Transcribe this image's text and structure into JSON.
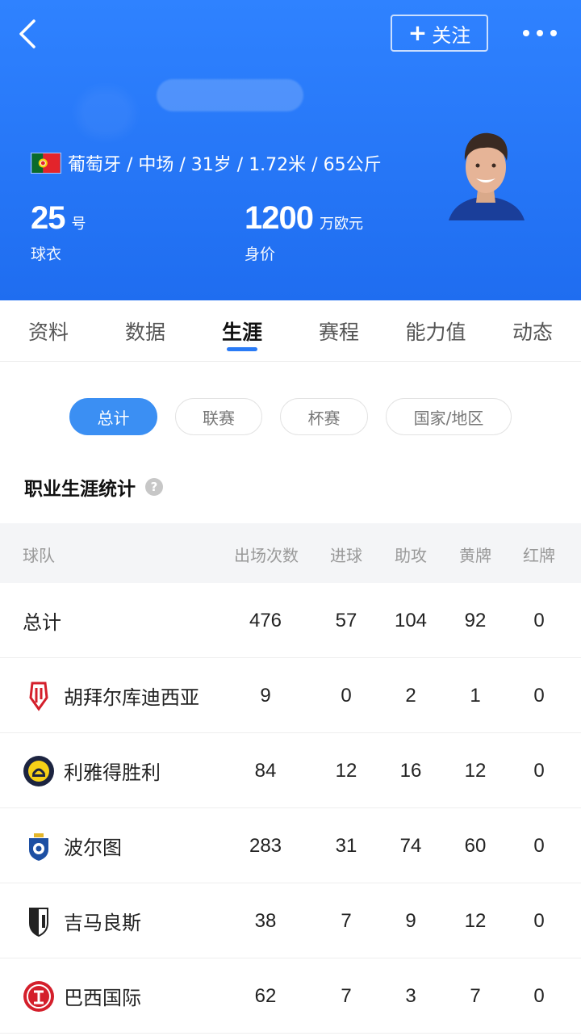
{
  "header": {
    "follow_label": "关注",
    "follow_plus": "+",
    "info_line": "葡萄牙 / 中场 / 31岁 / 1.72米 / 65公斤",
    "jersey": {
      "number": "25",
      "unit": "号",
      "label": "球衣"
    },
    "value": {
      "number": "1200",
      "unit": "万欧元",
      "label": "身价"
    }
  },
  "tabs": [
    "资料",
    "数据",
    "生涯",
    "赛程",
    "能力值",
    "动态"
  ],
  "active_tab": "生涯",
  "filters": [
    "总计",
    "联赛",
    "杯赛",
    "国家/地区"
  ],
  "active_filter": "总计",
  "section_title": "职业生涯统计",
  "help_icon": "?",
  "table": {
    "headers": [
      "球队",
      "出场次数",
      "进球",
      "助攻",
      "黄牌",
      "红牌"
    ],
    "rows": [
      {
        "team": "总计",
        "logo": "none",
        "apps": "476",
        "goals": "57",
        "assists": "104",
        "yellow": "92",
        "red": "0"
      },
      {
        "team": "胡拜尔库迪西亚",
        "logo": "al-qadsiah-logo",
        "apps": "9",
        "goals": "0",
        "assists": "2",
        "yellow": "1",
        "red": "0"
      },
      {
        "team": "利雅得胜利",
        "logo": "al-nassr-logo",
        "apps": "84",
        "goals": "12",
        "assists": "16",
        "yellow": "12",
        "red": "0"
      },
      {
        "team": "波尔图",
        "logo": "porto-logo",
        "apps": "283",
        "goals": "31",
        "assists": "74",
        "yellow": "60",
        "red": "0"
      },
      {
        "team": "吉马良斯",
        "logo": "vitoria-guimaraes-logo",
        "apps": "38",
        "goals": "7",
        "assists": "9",
        "yellow": "12",
        "red": "0"
      },
      {
        "team": "巴西国际",
        "logo": "internacional-logo",
        "apps": "62",
        "goals": "7",
        "assists": "3",
        "yellow": "7",
        "red": "0"
      }
    ]
  },
  "colors": {
    "header_bg": "#2578f7",
    "accent": "#2a7bf6",
    "pill_active": "#3b8ff3"
  }
}
